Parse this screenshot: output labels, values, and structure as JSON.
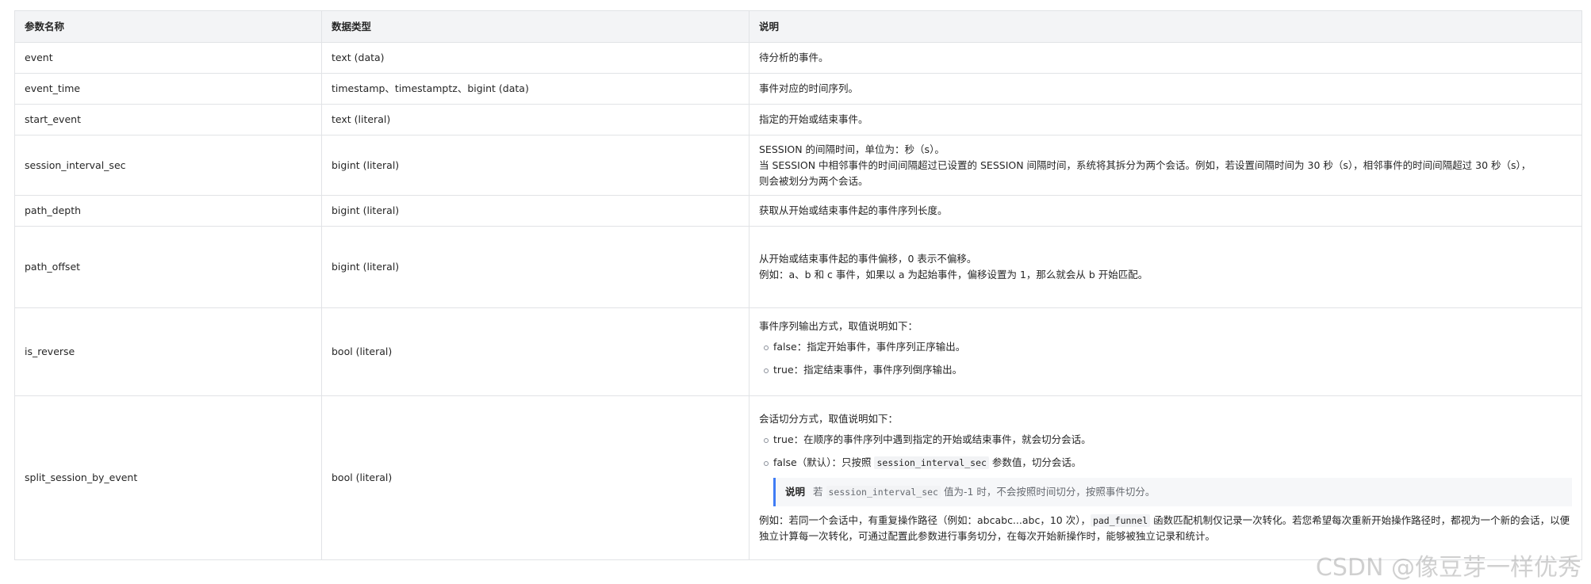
{
  "table": {
    "headers": [
      "参数名称",
      "数据类型",
      "说明"
    ],
    "rows": [
      {
        "name": "event",
        "type": "text (data)",
        "desc": [
          "待分析的事件。"
        ]
      },
      {
        "name": "event_time",
        "type": "timestamp、timestamptz、bigint (data)",
        "desc": [
          "事件对应的时间序列。"
        ]
      },
      {
        "name": "start_event",
        "type": "text (literal)",
        "desc": [
          "指定的开始或结束事件。"
        ]
      },
      {
        "name": "session_interval_sec",
        "type": "bigint (literal)",
        "desc": [
          "SESSION 的间隔时间，单位为：秒（s）。",
          "当 SESSION 中相邻事件的时间间隔超过已设置的 SESSION 间隔时间，系统将其拆分为两个会话。例如，若设置间隔时间为 30 秒（s），相邻事件的时间间隔超过 30 秒（s），",
          "则会被划分为两个会话。"
        ]
      },
      {
        "name": "path_depth",
        "type": "bigint (literal)",
        "desc": [
          "获取从开始或结束事件起的事件序列长度。"
        ]
      },
      {
        "name": "path_offset",
        "type": "bigint (literal)",
        "desc": [
          "从开始或结束事件起的事件偏移，0 表示不偏移。",
          "例如：a、b 和 c 事件，如果以 a 为起始事件，偏移设置为 1，那么就会从 b 开始匹配。"
        ]
      },
      {
        "name": "is_reverse",
        "type": "bool (literal)",
        "desc_intro": "事件序列输出方式，取值说明如下：",
        "bullets": [
          "false：指定开始事件，事件序列正序输出。",
          "true：指定结束事件，事件序列倒序输出。"
        ]
      },
      {
        "name": "split_session_by_event",
        "type": "bool (literal)",
        "desc_intro": "会话切分方式，取值说明如下：",
        "bullets": [
          "true：在顺序的事件序列中遇到指定的开始或结束事件，就会切分会话。"
        ],
        "bullet2": {
          "before": "false（默认）：只按照 ",
          "code": "session_interval_sec",
          "after": " 参数值，切分会话。"
        },
        "note": {
          "title": "说明",
          "before": "若 ",
          "code": "session_interval_sec",
          "after": " 值为-1 时，不会按照时间切分，按照事件切分。"
        },
        "example": {
          "before": "例如：若同一个会话中，有重复操作路径（例如：abcabc...abc，10 次），",
          "code": "pad_funnel",
          "after": " 函数匹配机制仅记录一次转化。若您希望每次重新开始操作路径时，都视为一个新的会话，以便独立计算每一次转化，可通过配置此参数进行事务切分，在每次开始新操作时，能够被独立记录和统计。"
        }
      }
    ]
  },
  "watermark": "CSDN @像豆芽一样优秀"
}
